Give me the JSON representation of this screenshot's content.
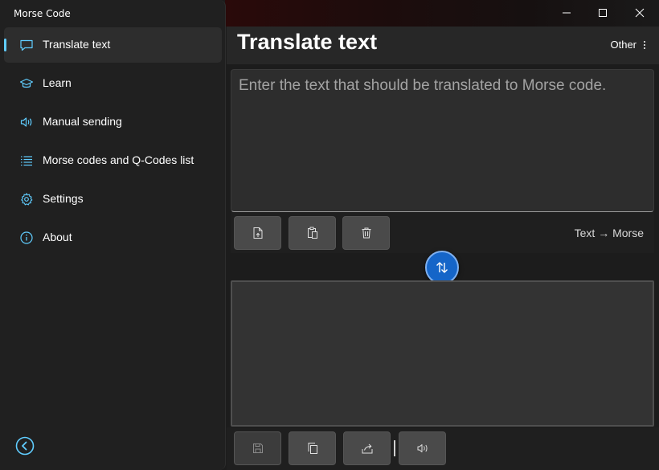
{
  "window": {
    "app_title": "Morse Code",
    "controls": [
      "minimize-icon",
      "maximize-icon",
      "close-icon"
    ]
  },
  "sidebar": {
    "items": [
      {
        "label": "Translate text",
        "icon": "chat-bubble-icon",
        "selected": true
      },
      {
        "label": "Learn",
        "icon": "graduation-cap-icon",
        "selected": false
      },
      {
        "label": "Manual sending",
        "icon": "speaker-icon",
        "selected": false
      },
      {
        "label": "Morse codes and Q-Codes list",
        "icon": "list-icon",
        "selected": false
      },
      {
        "label": "Settings",
        "icon": "gear-icon",
        "selected": false
      },
      {
        "label": "About",
        "icon": "info-icon",
        "selected": false
      }
    ],
    "back_icon": "back-arrow-icon"
  },
  "header": {
    "title": "Translate text",
    "other_label": "Other"
  },
  "input": {
    "placeholder": "Enter the text that should be translated to Morse code.",
    "value": ""
  },
  "input_toolbar": {
    "buttons": [
      "open-file-icon",
      "paste-icon",
      "delete-icon"
    ],
    "mode_label": "Text → Morse"
  },
  "swap": {
    "icon": "swap-vertical-icon"
  },
  "output": {
    "value": ""
  },
  "output_toolbar": {
    "buttons": [
      "save-icon",
      "copy-icon",
      "share-icon",
      "play-sound-icon"
    ]
  },
  "colors": {
    "accent": "#60cdff",
    "swap_button": "#1565c8",
    "sidebar_bg": "#202020",
    "content_bg": "#1c1c1c"
  }
}
